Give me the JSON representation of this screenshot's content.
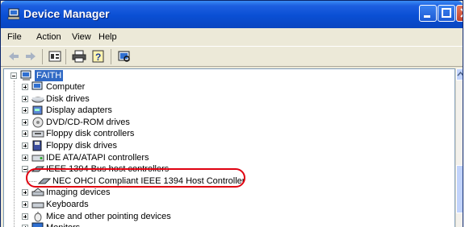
{
  "window": {
    "title": "Device Manager",
    "title_color": "#0a4fd4"
  },
  "menu": {
    "items": [
      "File",
      "Action",
      "View",
      "Help"
    ]
  },
  "toolbar": {
    "icons": [
      "back-arrow-icon",
      "forward-arrow-icon",
      "properties-icon",
      "print-icon",
      "help-icon",
      "scan-hardware-icon"
    ]
  },
  "tree": {
    "root": "FAITH",
    "items": [
      {
        "label": "Computer",
        "icon": "computer-icon",
        "expanded": false
      },
      {
        "label": "Disk drives",
        "icon": "disk-drive-icon",
        "expanded": false
      },
      {
        "label": "Display adapters",
        "icon": "display-adapter-icon",
        "expanded": false
      },
      {
        "label": "DVD/CD-ROM drives",
        "icon": "dvd-drive-icon",
        "expanded": false
      },
      {
        "label": "Floppy disk controllers",
        "icon": "floppy-controller-icon",
        "expanded": false
      },
      {
        "label": "Floppy disk drives",
        "icon": "floppy-drive-icon",
        "expanded": false
      },
      {
        "label": "IDE ATA/ATAPI controllers",
        "icon": "ide-controller-icon",
        "expanded": false
      },
      {
        "label": "IEEE 1394 Bus host controllers",
        "icon": "ieee1394-icon",
        "expanded": true
      },
      {
        "label": "NEC OHCI Compliant IEEE 1394 Host Controller",
        "icon": "ieee1394-device-icon",
        "child": true
      },
      {
        "label": "Imaging devices",
        "icon": "imaging-device-icon",
        "expanded": false
      },
      {
        "label": "Keyboards",
        "icon": "keyboard-icon",
        "expanded": false
      },
      {
        "label": "Mice and other pointing devices",
        "icon": "mouse-icon",
        "expanded": false
      },
      {
        "label": "Monitors",
        "icon": "monitor-icon",
        "expanded": false
      }
    ]
  },
  "annotation": {
    "color": "#e00010"
  }
}
